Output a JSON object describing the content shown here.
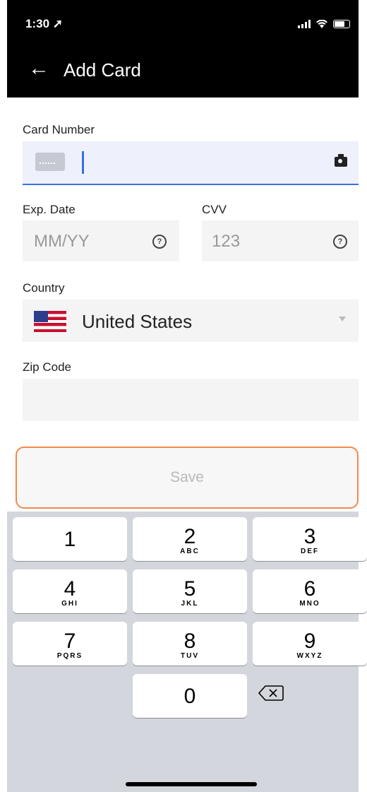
{
  "status_bar": {
    "time": "1:30"
  },
  "header": {
    "title": "Add Card"
  },
  "form": {
    "card_number": {
      "label": "Card Number",
      "value": ""
    },
    "exp_date": {
      "label": "Exp. Date",
      "placeholder": "MM/YY"
    },
    "cvv": {
      "label": "CVV",
      "placeholder": "123"
    },
    "country": {
      "label": "Country",
      "value": "United States"
    },
    "zip_code": {
      "label": "Zip Code",
      "value": ""
    }
  },
  "save_button": {
    "label": "Save"
  },
  "keypad": [
    {
      "num": "1",
      "letters": ""
    },
    {
      "num": "2",
      "letters": "ABC"
    },
    {
      "num": "3",
      "letters": "DEF"
    },
    {
      "num": "4",
      "letters": "GHI"
    },
    {
      "num": "5",
      "letters": "JKL"
    },
    {
      "num": "6",
      "letters": "MNO"
    },
    {
      "num": "7",
      "letters": "PQRS"
    },
    {
      "num": "8",
      "letters": "TUV"
    },
    {
      "num": "9",
      "letters": "WXYZ"
    },
    {
      "num": "0",
      "letters": ""
    }
  ],
  "colors": {
    "accent": "#3a6fe0",
    "save_border": "#f08a4a",
    "keyboard_bg": "#d3d6dc"
  },
  "icons": [
    "back-arrow-icon",
    "card-icon",
    "camera-icon",
    "help-icon",
    "us-flag-icon",
    "chevron-down-icon",
    "backspace-icon"
  ]
}
